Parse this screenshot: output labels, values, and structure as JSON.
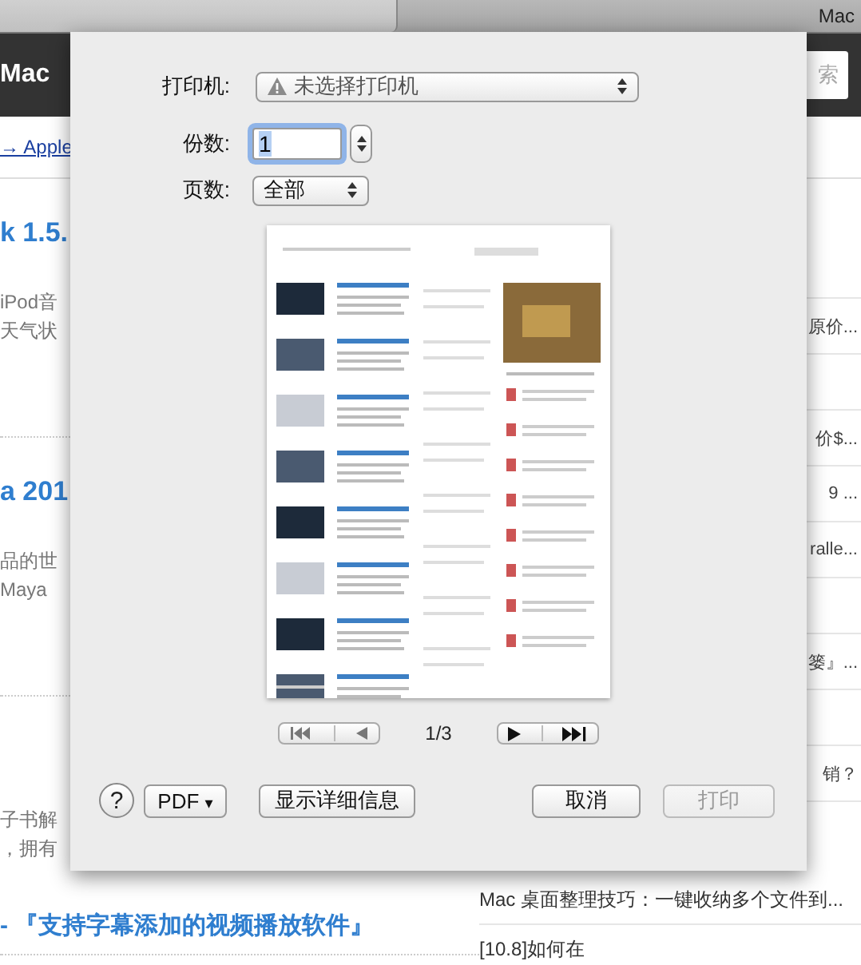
{
  "browser": {
    "tab_title": "Mac"
  },
  "site_header": {
    "title": "Mac",
    "search": {
      "placeholder": "索"
    }
  },
  "breadcrumb": {
    "link": "→ Apple"
  },
  "left_sections": [
    {
      "title": "k 1.5.",
      "lines": [
        "iPod音",
        "天气状"
      ]
    },
    {
      "title": "a 201",
      "lines": [
        "品的世",
        "Maya"
      ]
    },
    {
      "lines": [
        "子书解",
        "，拥有"
      ]
    }
  ],
  "right_rows": [
    "",
    "原价...",
    "",
    "价$...",
    "9 ...",
    "ralle...",
    "",
    "篓』...",
    "",
    "销？"
  ],
  "bottom_left_title": "- 『支持字幕添加的视频播放软件』",
  "bottom_right_links": [
    "Mac 桌面整理技巧：一键收纳多个文件到...",
    "[10.8]如何在"
  ],
  "print_dialog": {
    "printer": {
      "label": "打印机:",
      "value": "未选择打印机",
      "warning": true
    },
    "copies": {
      "label": "份数:",
      "value": "1"
    },
    "pages": {
      "label": "页数:",
      "value": "全部"
    },
    "page_indicator": "1/3",
    "help": "?",
    "pdf_button": "PDF",
    "pdf_menu_arrow": "▾",
    "buttons": [
      {
        "label": "显示详细信息",
        "kind": "details",
        "disabled": false
      },
      {
        "label": "取消",
        "kind": "cancel",
        "disabled": false
      },
      {
        "label": "打印",
        "kind": "print",
        "disabled": true
      }
    ]
  }
}
